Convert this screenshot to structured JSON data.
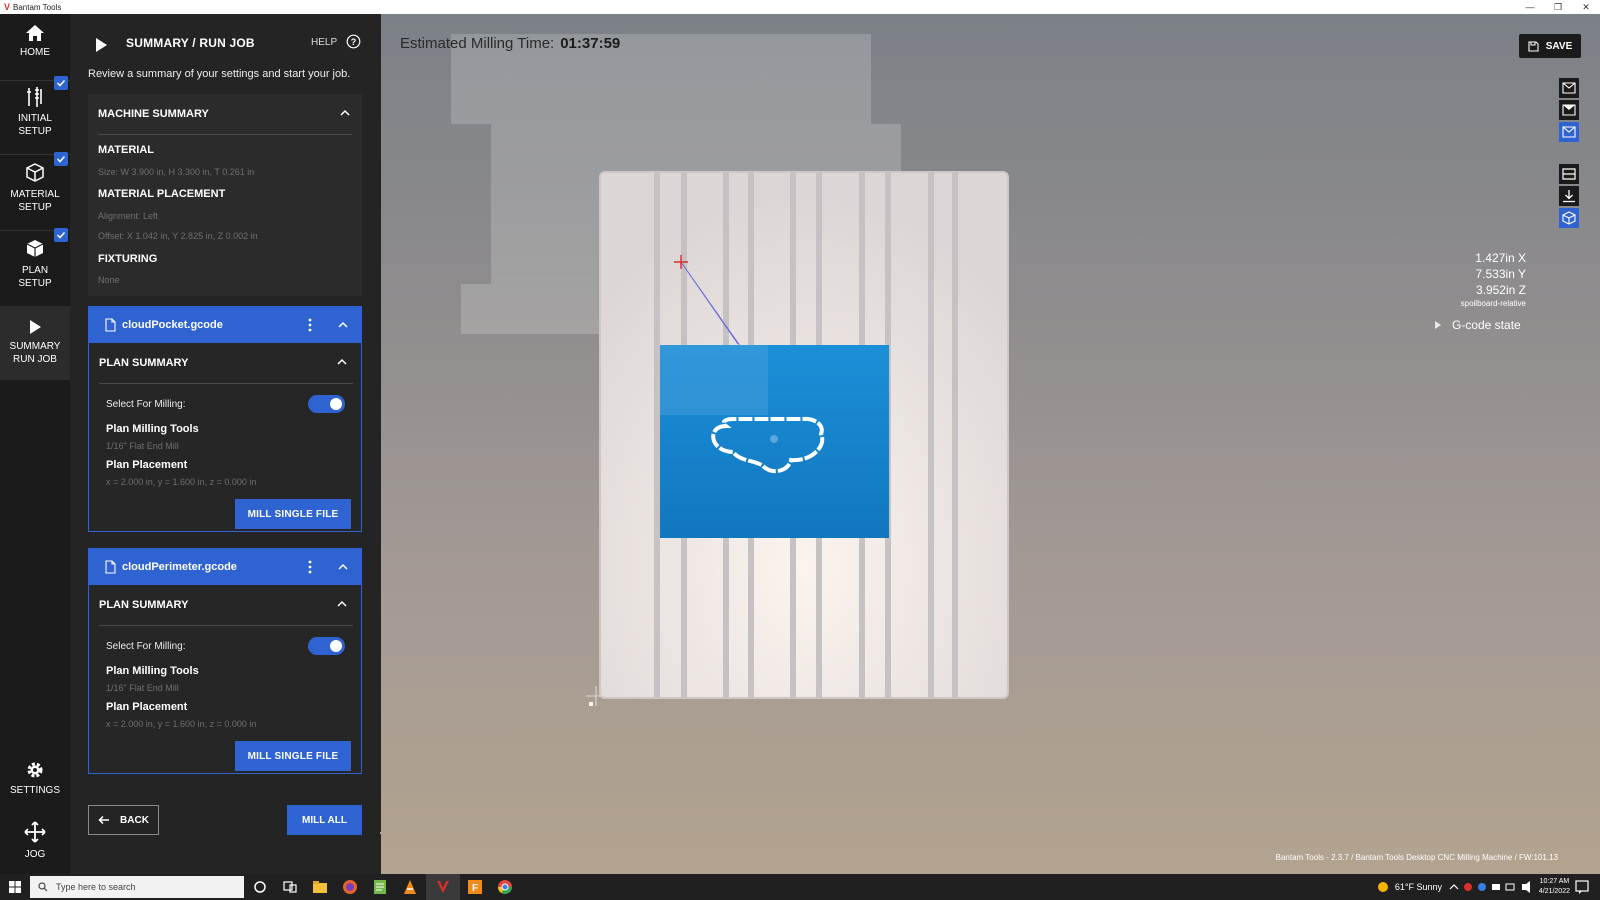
{
  "window": {
    "title": "Bantam Tools",
    "logo": "V"
  },
  "rail": {
    "home": "HOME",
    "initial_setup": [
      "INITIAL",
      "SETUP"
    ],
    "material_setup": [
      "MATERIAL",
      "SETUP"
    ],
    "plan_setup": [
      "PLAN",
      "SETUP"
    ],
    "summary_run_job": [
      "SUMMARY",
      "RUN JOB"
    ],
    "settings": "SETTINGS",
    "jog": "JOG"
  },
  "panel": {
    "title": "SUMMARY / RUN JOB",
    "help": "HELP",
    "description": "Review a summary of your settings and start your job.",
    "machine_summary": {
      "title": "MACHINE SUMMARY",
      "material_title": "MATERIAL",
      "material_size": "Size:  W 3.900 in, H 3.300 in, T 0.261 in",
      "placement_title": "MATERIAL PLACEMENT",
      "alignment": "Alignment:  Left",
      "offset": "Offset:  X 1.042 in, Y 2.825 in, Z 0.002 in",
      "fixturing_title": "FIXTURING",
      "fixturing_value": "None"
    },
    "files": [
      {
        "name": "cloudPocket.gcode",
        "plan_summary": "PLAN SUMMARY",
        "select_label": "Select For Milling:",
        "tools_title": "Plan Milling Tools",
        "tools_value": "1/16\" Flat End Mill",
        "placement_title": "Plan Placement",
        "placement_value": "x = 2.000 in, y = 1.600 in, z = 0.000 in",
        "button": "MILL SINGLE FILE"
      },
      {
        "name": "cloudPerimeter.gcode",
        "plan_summary": "PLAN SUMMARY",
        "select_label": "Select For Milling:",
        "tools_title": "Plan Milling Tools",
        "tools_value": "1/16\" Flat End Mill",
        "placement_title": "Plan Placement",
        "placement_value": "x = 2.000 in, y = 1.600 in, z = 0.000 in",
        "button": "MILL SINGLE FILE"
      }
    ],
    "back": "BACK",
    "mill_all": "MILL ALL"
  },
  "canvas": {
    "estimate_label": "Estimated Milling Time:",
    "estimate_value": "01:37:59",
    "save": "SAVE",
    "coords": {
      "x": "1.427in X",
      "y": "7.533in Y",
      "z": "3.952in Z",
      "ref": "spoilboard-relative"
    },
    "gcode_state": "G-code state",
    "footer": "Bantam Tools - 2.3.7 / Bantam Tools Desktop CNC Milling Machine / FW:101.13"
  },
  "taskbar": {
    "search_placeholder": "Type here to search",
    "weather": "61°F  Sunny",
    "time": "10:27 AM",
    "date": "4/21/2022"
  },
  "colors": {
    "accent": "#2f63d2",
    "panel": "#242424",
    "rail": "#1b1b1b",
    "material": "#1a87d1"
  }
}
